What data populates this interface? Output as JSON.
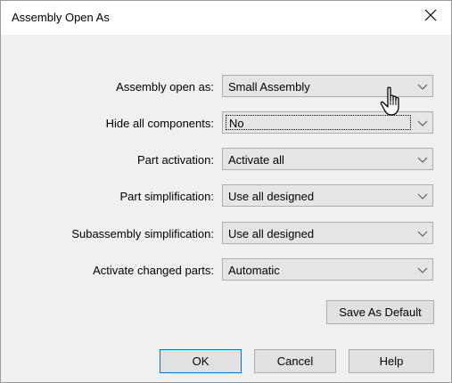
{
  "dialog": {
    "title": "Assembly Open As",
    "close_icon": "close-icon"
  },
  "fields": [
    {
      "label": "Assembly open as:",
      "value": "Small Assembly"
    },
    {
      "label": "Hide all components:",
      "value": "No"
    },
    {
      "label": "Part activation:",
      "value": "Activate all"
    },
    {
      "label": "Part simplification:",
      "value": "Use all designed"
    },
    {
      "label": "Subassembly simplification:",
      "value": "Use all designed"
    },
    {
      "label": "Activate changed parts:",
      "value": "Automatic"
    }
  ],
  "buttons": {
    "save_default": "Save As Default",
    "ok": "OK",
    "cancel": "Cancel",
    "help": "Help"
  },
  "colors": {
    "dialog_bg": "#f0f0f0",
    "select_bg": "#e5e5e5",
    "default_button_border": "#0078d7"
  },
  "icons": {
    "dropdown": "chevron-down-icon",
    "cursor": "hand-pointer-icon"
  }
}
